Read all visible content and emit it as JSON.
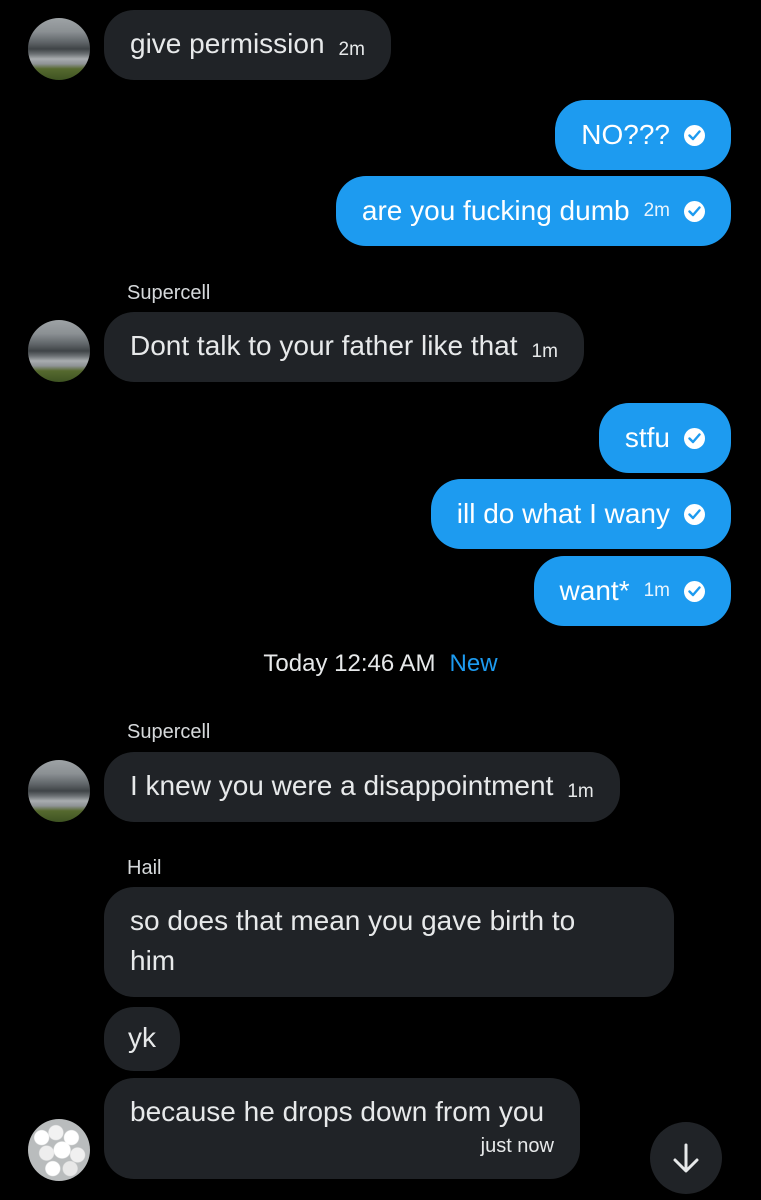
{
  "colors": {
    "background": "#000000",
    "incoming_bubble": "#202327",
    "outgoing_bubble": "#1d9bf0",
    "accent": "#1d9bf0"
  },
  "messages": [
    {
      "direction": "incoming",
      "text": "give permission",
      "time": "2m",
      "avatar": "storm-avatar"
    },
    {
      "direction": "outgoing",
      "text": "NO???",
      "time": "",
      "seen": true
    },
    {
      "direction": "outgoing",
      "text": "are you fucking dumb",
      "time": "2m",
      "seen": true
    },
    {
      "direction": "incoming",
      "sender": "Supercell",
      "text": "Dont talk to your father like that",
      "time": "1m",
      "avatar": "storm-avatar"
    },
    {
      "direction": "outgoing",
      "text": "stfu",
      "time": "",
      "seen": true
    },
    {
      "direction": "outgoing",
      "text": "ill do what I wany",
      "time": "",
      "seen": true
    },
    {
      "direction": "outgoing",
      "text": "want*",
      "time": "1m",
      "seen": true
    },
    {
      "direction": "incoming",
      "sender": "Supercell",
      "text": "I knew you were a disappointment",
      "time": "1m",
      "avatar": "storm-avatar"
    },
    {
      "direction": "incoming",
      "sender": "Hail",
      "text_line1": "so does that mean you gave birth to",
      "text_line2": "him"
    },
    {
      "direction": "incoming",
      "text": "yk"
    },
    {
      "direction": "incoming",
      "text": "because he drops down from you",
      "time": "just now",
      "avatar": "hail-avatar"
    }
  ],
  "date_separator": {
    "label": "Today 12:46 AM",
    "new_label": "New"
  },
  "icons": {
    "seen": "check-circle-icon",
    "scroll": "arrow-down-icon"
  }
}
